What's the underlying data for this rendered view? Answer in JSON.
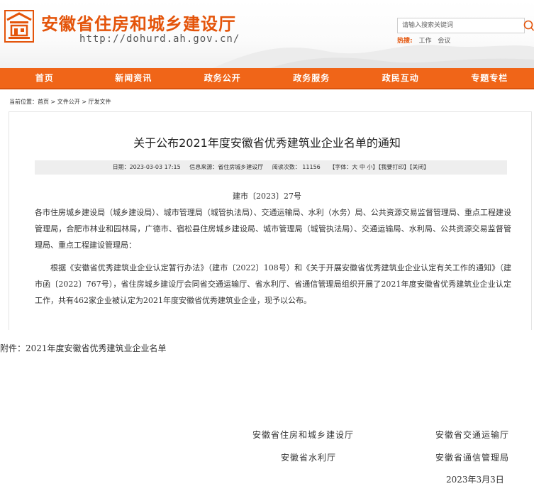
{
  "header": {
    "site_title": "安徽省住房和城乡建设厅",
    "site_url": "http://dohurd.ah.gov.cn/",
    "logo_icon": "building-logo-icon",
    "search": {
      "placeholder": "请输入搜索关键词",
      "icon": "search-icon"
    },
    "hot": {
      "label": "热搜:",
      "links": [
        "工作",
        "会议"
      ]
    }
  },
  "nav": {
    "items": [
      "首页",
      "新闻资讯",
      "政务公开",
      "政务服务",
      "政民互动",
      "专题专栏"
    ],
    "color": "#f06518"
  },
  "breadcrumb": "当前位置：首页 > 文件公开 > 厅发文件",
  "article": {
    "title": "关于公布2021年度安徽省优秀建筑业企业名单的通知",
    "meta": {
      "date": "日期：2023-03-03 17:15",
      "source": "信息来源：省住房城乡建设厅",
      "views": "阅读次数：  11156",
      "tools": "【字体：大 中 小】【我要打印】【关闭】"
    },
    "doc_number": "建市〔2023〕27号",
    "paragraph1": "各市住房城乡建设局（城乡建设局）、城市管理局（城管执法局）、交通运输局、水利（水务）局、公共资源交易监督管理局、重点工程建设管理局，合肥市林业和园林局，广德市、宿松县住房城乡建设局、城市管理局（城管执法局）、交通运输局、水利局、公共资源交易监督管理局、重点工程建设管理局：",
    "paragraph2": "根据《安徽省优秀建筑业企业认定暂行办法》（建市〔2022〕108号）和《关于开展安徽省优秀建筑业企业认定有关工作的通知》（建市函〔2022〕767号），省住房城乡建设厅会同省交通运输厅、省水利厅、省通信管理局组织开展了2021年度安徽省优秀建筑业企业认定工作，共有462家企业被认定为2021年度安徽省优秀建筑业企业，现予以公布。",
    "attachment": "附件：2021年度安徽省优秀建筑业企业名单",
    "signatures": [
      "安徽省住房和城乡建设厅",
      "安徽省交通运输厅",
      "安徽省水利厅",
      "安徽省通信管理局"
    ],
    "sign_date": "2023年3月3日"
  }
}
